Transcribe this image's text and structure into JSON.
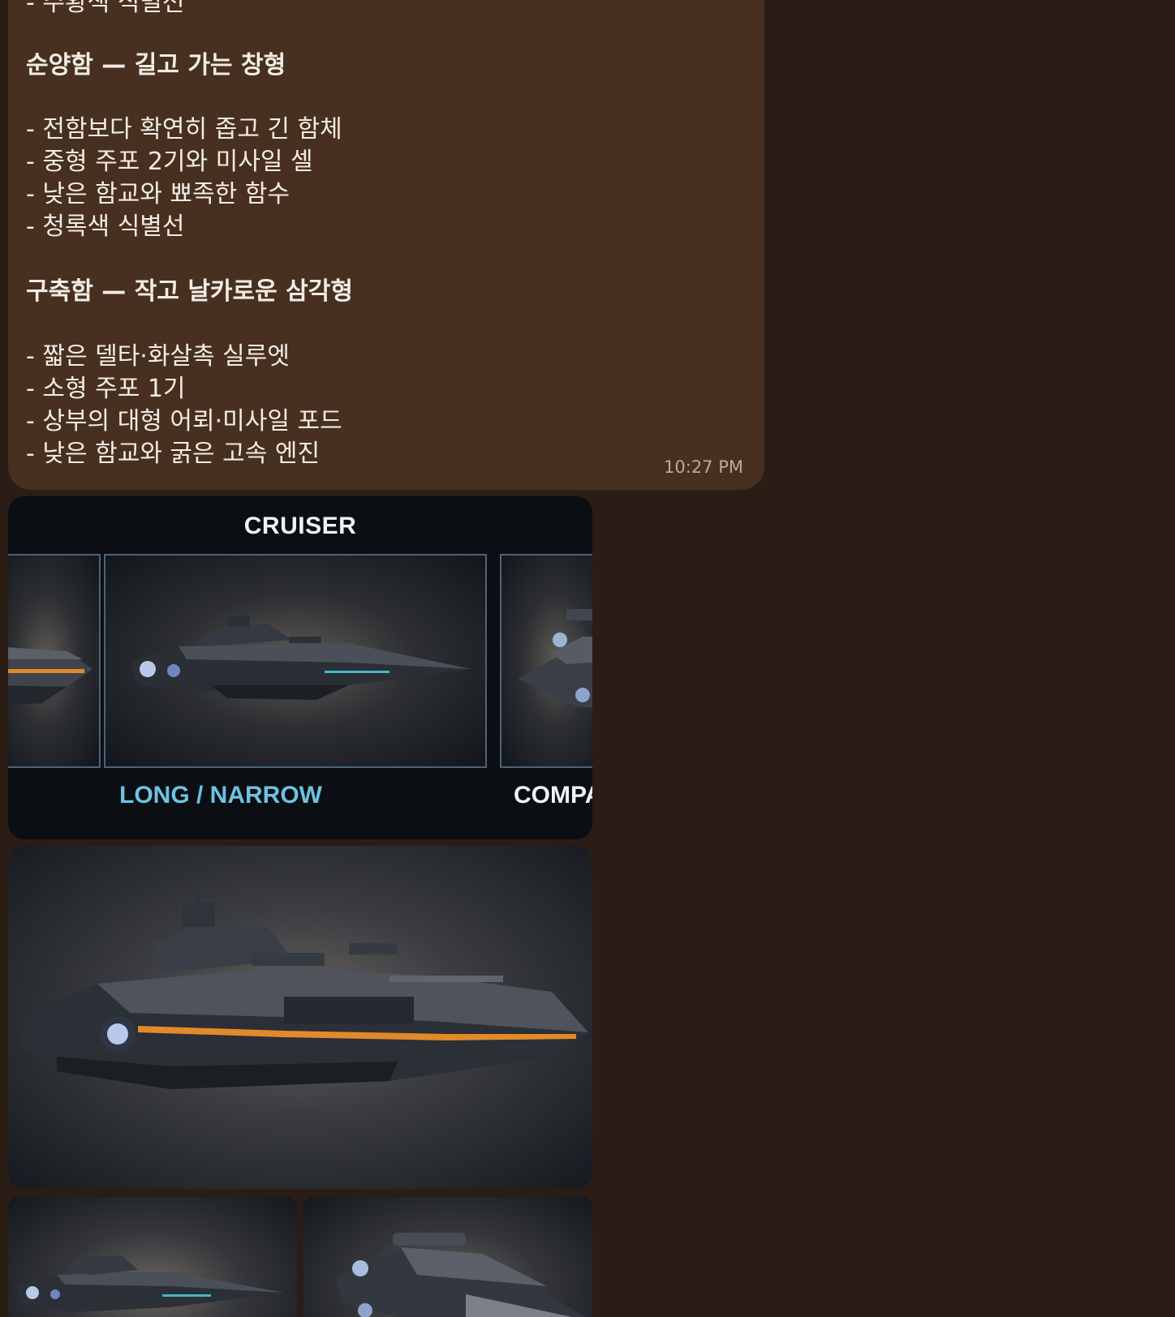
{
  "message": {
    "lines": [
      {
        "text": "- 주황색 식별선",
        "heading": false
      },
      {
        "text": "순양함 — 길고 가는 창형",
        "heading": true
      },
      {
        "text": "- 전함보다 확연히 좁고 긴 함체",
        "heading": false
      },
      {
        "text": "- 중형 주포 2기와 미사일 셀",
        "heading": false
      },
      {
        "text": "- 낮은 함교와 뾰족한 함수",
        "heading": false
      },
      {
        "text": "- 청록색 식별선",
        "heading": false
      },
      {
        "text": "구축함 — 작고 날카로운 삼각형",
        "heading": true
      },
      {
        "text": "- 짧은 델타·화살촉 실루엣",
        "heading": false
      },
      {
        "text": "- 소형 주포 1기",
        "heading": false
      },
      {
        "text": "- 상부의 대형 어뢰·미사일 포드",
        "heading": false
      },
      {
        "text": "- 낮은 함교와 굵은 고속 엔진",
        "heading": false
      }
    ],
    "time": "10:27 PM"
  },
  "media": {
    "cruiser_card": {
      "title": "CRUISER",
      "label_center": "LONG / NARROW",
      "label_right": "COMPA"
    }
  },
  "colors": {
    "background": "#2a1d16",
    "bubble": "#47301f",
    "accent_teal": "#6cc3e0",
    "accent_orange": "#e08a2a"
  }
}
